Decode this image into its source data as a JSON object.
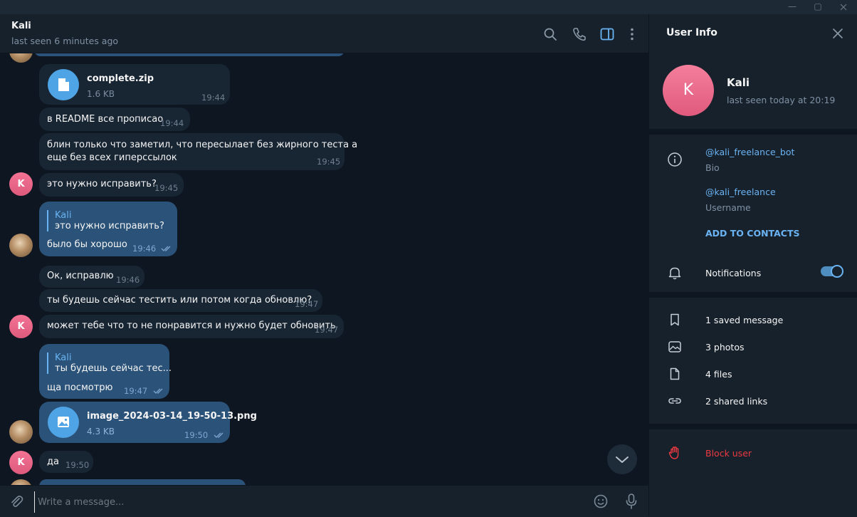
{
  "window": {
    "min_glyph": "—",
    "max_glyph": "▢"
  },
  "header": {
    "title": "Kali",
    "status": "last seen 6 minutes ago",
    "icons": [
      "search-icon",
      "phone-icon",
      "sidebar-toggle-icon",
      "more-vertical-icon"
    ]
  },
  "messages": [
    {
      "type": "file",
      "name": "complete.zip",
      "size": "1.6 KB",
      "time": "19:44",
      "direction": "in"
    },
    {
      "type": "text",
      "text": "в README все прописао",
      "time": "19:44",
      "direction": "in"
    },
    {
      "type": "text",
      "lines": [
        "блин только что заметил, что пересылает без жирного теста а",
        "еще без всех гиперссылок"
      ],
      "time": "19:45",
      "direction": "in"
    },
    {
      "type": "text",
      "text": "это нужно исправить?",
      "time": "19:45",
      "direction": "in",
      "avatar": "K"
    },
    {
      "type": "reply",
      "reply_name": "Kali",
      "reply_text": "это нужно исправить?",
      "text": "было бы хорошо",
      "time": "19:46",
      "direction": "out"
    },
    {
      "type": "text",
      "text": "Ок, исправлю",
      "time": "19:46",
      "direction": "in"
    },
    {
      "type": "text",
      "text": "ты будешь сейчас тестить или потом когда обновлю?",
      "time": "19:47",
      "direction": "in"
    },
    {
      "type": "text",
      "text": "может тебе что то не понравится и нужно будет обновить",
      "time": "19:47",
      "direction": "in",
      "avatar": "K"
    },
    {
      "type": "reply",
      "reply_name": "Kali",
      "reply_text": "ты будешь сейчас тес...",
      "text": "ща посмотрю",
      "time": "19:47",
      "direction": "out"
    },
    {
      "type": "file",
      "name": "image_2024-03-14_19-50-13.png",
      "size": "4.3 KB",
      "time": "19:50",
      "direction": "out"
    },
    {
      "type": "text",
      "text": "да",
      "time": "19:50",
      "direction": "in",
      "avatar": "K"
    }
  ],
  "composer": {
    "placeholder": "Write a message..."
  },
  "panel": {
    "title": "User Info",
    "avatar_letter": "K",
    "name": "Kali",
    "status": "last seen today at 20:19",
    "bio_value": "@kali_freelance_bot",
    "bio_label": "Bio",
    "username_value": "@kali_freelance",
    "username_label": "Username",
    "add_contact": "ADD TO CONTACTS",
    "notifications_label": "Notifications",
    "notifications_on": true,
    "media": [
      {
        "label": "1 saved message",
        "icon": "bookmark-icon"
      },
      {
        "label": "3 photos",
        "icon": "photo-icon"
      },
      {
        "label": "4 files",
        "icon": "file-icon"
      },
      {
        "label": "2 shared links",
        "icon": "link-icon"
      }
    ],
    "block": "Block user"
  },
  "colors": {
    "accent": "#6ab3f3",
    "danger": "#ec3942",
    "outgoing": "#2b5278",
    "incoming": "#182533"
  }
}
